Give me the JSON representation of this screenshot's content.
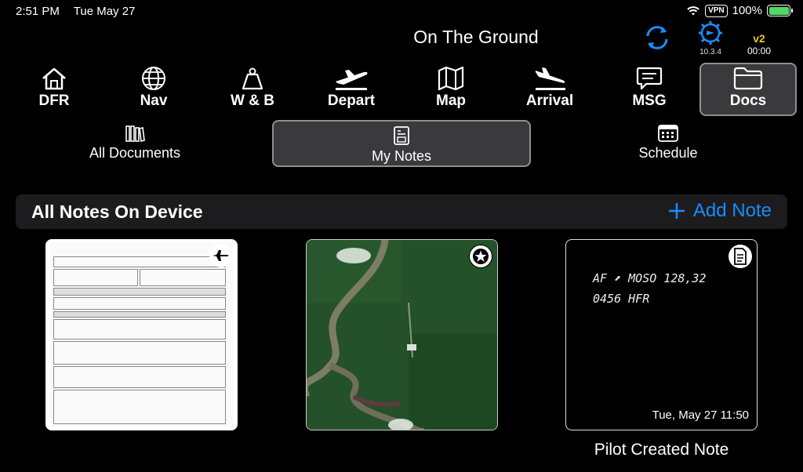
{
  "status_bar": {
    "time": "2:51 PM",
    "date": "Tue May 27",
    "vpn": "VPN",
    "battery_pct": "100%"
  },
  "header": {
    "title": "On The Ground",
    "app_version": "10.3.4",
    "version_tag": "v2",
    "timer": "00:00"
  },
  "nav": [
    {
      "label": "DFR",
      "icon": "house-icon"
    },
    {
      "label": "Nav",
      "icon": "globe-icon"
    },
    {
      "label": "W & B",
      "icon": "weight-icon"
    },
    {
      "label": "Depart",
      "icon": "plane-departure-icon"
    },
    {
      "label": "Map",
      "icon": "map-icon"
    },
    {
      "label": "Arrival",
      "icon": "plane-arrival-icon"
    },
    {
      "label": "MSG",
      "icon": "message-icon"
    },
    {
      "label": "Docs",
      "icon": "folder-icon"
    }
  ],
  "subnav": [
    {
      "label": "All Documents",
      "icon": "books-icon"
    },
    {
      "label": "My Notes",
      "icon": "note-icon"
    },
    {
      "label": "Schedule",
      "icon": "calendar-icon"
    }
  ],
  "section": {
    "title": "All Notes On Device",
    "add_label": "Add Note"
  },
  "notes": [
    {
      "type": "document",
      "badge": "plane-icon"
    },
    {
      "type": "map",
      "badge": "star-icon"
    },
    {
      "type": "handwritten",
      "badge": "document-icon",
      "line1": "AF ⬈ MOSO   128,32",
      "line2": "0456   HFR",
      "date": "Tue, May 27  11:50",
      "caption": "Pilot Created Note"
    }
  ],
  "colors": {
    "accent": "#1a8cff",
    "active_bg": "#3a3a3c",
    "version": "#e8c21b",
    "battery": "#4cd964"
  }
}
